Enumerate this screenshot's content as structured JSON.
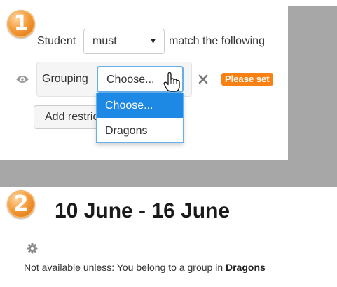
{
  "restriction": {
    "step": "1",
    "student_label": "Student",
    "must_value": "must",
    "match_label": "match the following",
    "grouping_label": "Grouping",
    "grouping_select_value": "Choose...",
    "dropdown_options": [
      "Choose...",
      "Dragons"
    ],
    "please_set_badge": "Please set",
    "add_button_label": "Add restrictions...",
    "accent_color": "#1e88e5",
    "badge_color": "#f98012"
  },
  "section": {
    "step": "2",
    "title": "10 June - 16 June",
    "availability_prefix": "Not available unless: You belong to a group in ",
    "availability_group": "Dragons"
  }
}
